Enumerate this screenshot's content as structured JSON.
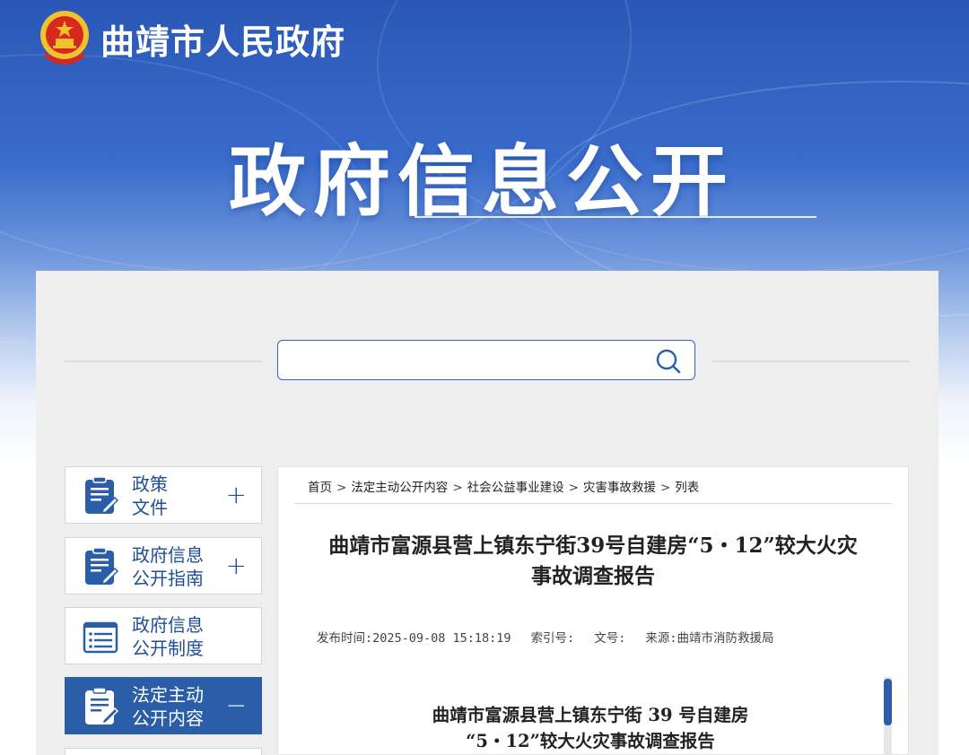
{
  "header": {
    "site_title": "曲靖市人民政府",
    "banner_title": "政府信息公开"
  },
  "search": {
    "value": "",
    "placeholder": ""
  },
  "sidebar": {
    "items": [
      {
        "line1": "政策",
        "line2": "文件",
        "toggle": "+",
        "icon": "document-edit-icon",
        "active": false
      },
      {
        "line1": "政府信息",
        "line2": "公开指南",
        "toggle": "+",
        "icon": "document-edit-icon",
        "active": false
      },
      {
        "line1": "政府信息",
        "line2": "公开制度",
        "toggle": "",
        "icon": "list-icon",
        "active": false
      },
      {
        "line1": "法定主动",
        "line2": "公开内容",
        "toggle": "−",
        "icon": "document-edit-icon",
        "active": true
      }
    ]
  },
  "breadcrumb": [
    "首页",
    "法定主动公开内容",
    "社会公益事业建设",
    "灾害事故救援",
    "列表"
  ],
  "breadcrumb_sep": ">",
  "article": {
    "title_line1": "曲靖市富源县营上镇东宁街39号自建房“5・12”较大火灾",
    "title_line2": "事故调查报告",
    "meta": {
      "publish_time": "发布时间:2025-09-08 15:18:19",
      "index_no": "索引号:",
      "doc_no": "文号:",
      "source": "来源:曲靖市消防救援局"
    },
    "body_title_line1": "曲靖市富源县营上镇东宁街 39 号自建房",
    "body_title_line2": "“5・12”较大火灾事故调查报告"
  },
  "colors": {
    "brand_blue": "#2b5ea8",
    "banner_top": "#2a57b6",
    "panel_bg": "#eeeeee",
    "emblem_red": "#d6281e",
    "emblem_gold": "#f2c12e"
  }
}
